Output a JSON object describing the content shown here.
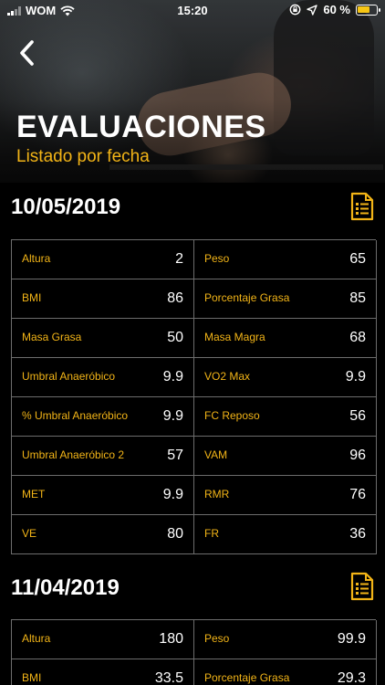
{
  "status_bar": {
    "carrier": "WOM",
    "time": "15:20",
    "battery": "60 %",
    "icons": [
      "signal-icon",
      "wifi-icon",
      "orientation-lock-icon",
      "location-icon",
      "battery-icon"
    ]
  },
  "header": {
    "back_icon": "chevron-left-icon",
    "title": "EVALUACIONES",
    "subtitle": "Listado por fecha"
  },
  "colors": {
    "accent": "#f2b417",
    "background": "#000000",
    "border": "#6d6d6d"
  },
  "evaluations": [
    {
      "date": "10/05/2019",
      "icon": "document-list-icon",
      "rows": [
        [
          {
            "label": "Altura",
            "value": "2"
          },
          {
            "label": "Peso",
            "value": "65"
          }
        ],
        [
          {
            "label": "BMI",
            "value": "86"
          },
          {
            "label": "Porcentaje Grasa",
            "value": "85"
          }
        ],
        [
          {
            "label": "Masa Grasa",
            "value": "50"
          },
          {
            "label": "Masa Magra",
            "value": "68"
          }
        ],
        [
          {
            "label": "Umbral Anaeróbico",
            "value": "9.9"
          },
          {
            "label": "VO2 Max",
            "value": "9.9"
          }
        ],
        [
          {
            "label": "% Umbral Anaeróbico",
            "value": "9.9"
          },
          {
            "label": "FC Reposo",
            "value": "56"
          }
        ],
        [
          {
            "label": "Umbral Anaeróbico 2",
            "value": "57"
          },
          {
            "label": "VAM",
            "value": "96"
          }
        ],
        [
          {
            "label": "MET",
            "value": "9.9"
          },
          {
            "label": "RMR",
            "value": "76"
          }
        ],
        [
          {
            "label": "VE",
            "value": "80"
          },
          {
            "label": "FR",
            "value": "36"
          }
        ]
      ]
    },
    {
      "date": "11/04/2019",
      "icon": "document-list-icon",
      "rows": [
        [
          {
            "label": "Altura",
            "value": "180"
          },
          {
            "label": "Peso",
            "value": "99.9"
          }
        ],
        [
          {
            "label": "BMI",
            "value": "33.5"
          },
          {
            "label": "Porcentaje Grasa",
            "value": "29.3"
          }
        ]
      ]
    }
  ]
}
